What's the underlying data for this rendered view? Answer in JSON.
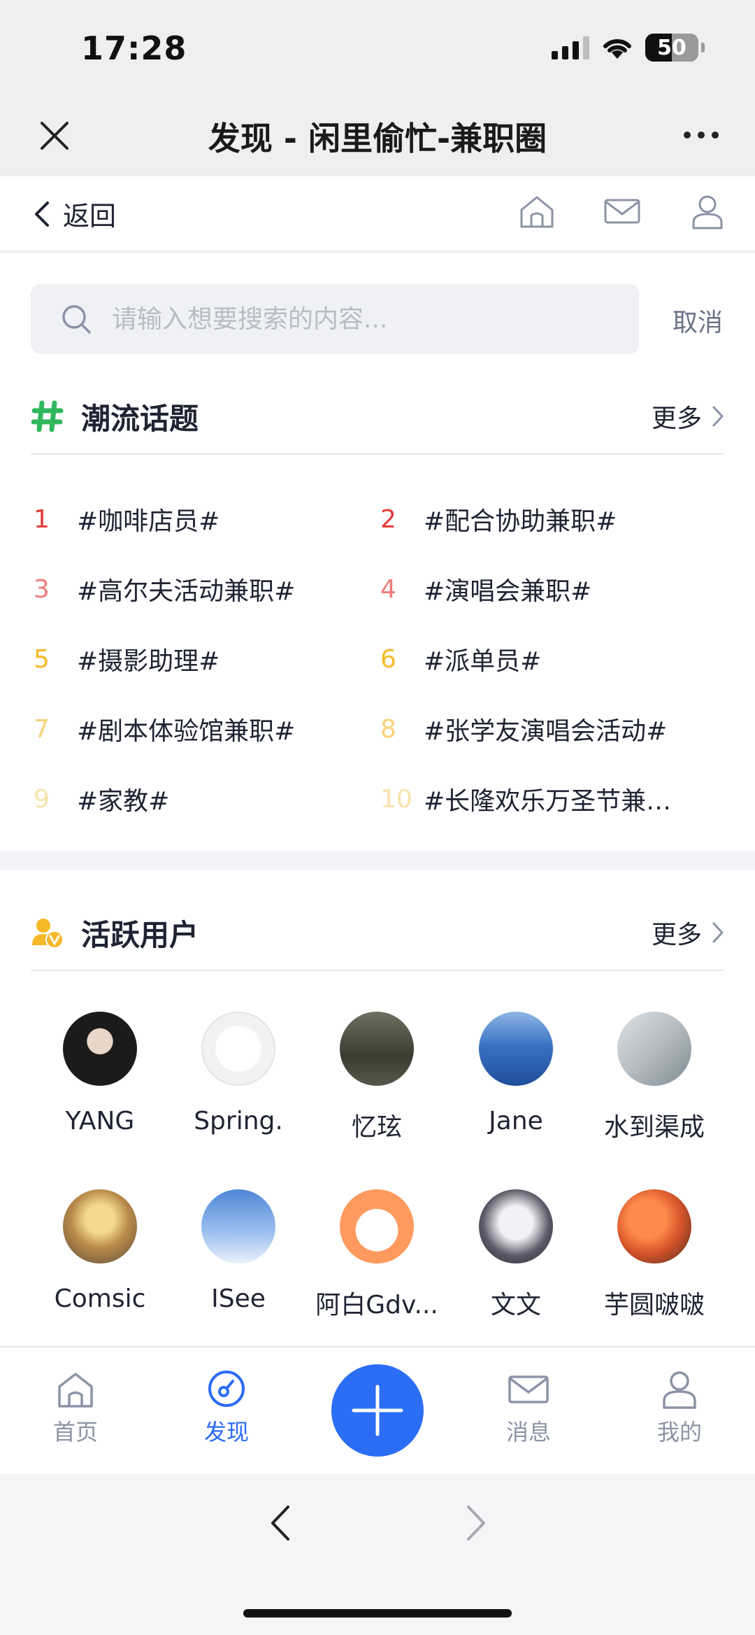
{
  "status_bar": {
    "time": "17:28",
    "battery": "50",
    "battery_level": 0.5
  },
  "title_bar": {
    "title": "发现 - 闲里偷忙-兼职圈"
  },
  "nav_bar": {
    "back_label": "返回"
  },
  "search": {
    "placeholder": "请输入想要搜索的内容...",
    "cancel_label": "取消"
  },
  "trending": {
    "title": "潮流话题",
    "more_label": "更多",
    "icon_color": "#2fb75b",
    "topics": [
      {
        "rank": "1",
        "name": "#咖啡店员#",
        "color": "#e53b3b"
      },
      {
        "rank": "2",
        "name": "#配合协助兼职#",
        "color": "#e53b3b"
      },
      {
        "rank": "3",
        "name": "#高尔夫活动兼职#",
        "color": "#ef7b7b"
      },
      {
        "rank": "4",
        "name": "#演唱会兼职#",
        "color": "#ef7b7b"
      },
      {
        "rank": "5",
        "name": "#摄影助理#",
        "color": "#f5b827"
      },
      {
        "rank": "6",
        "name": "#派单员#",
        "color": "#f5b827"
      },
      {
        "rank": "7",
        "name": "#剧本体验馆兼职#",
        "color": "#f7d376"
      },
      {
        "rank": "8",
        "name": "#张学友演唱会活动#",
        "color": "#f7d376"
      },
      {
        "rank": "9",
        "name": "#家教#",
        "color": "#f8e3a8"
      },
      {
        "rank": "10",
        "name": "#长隆欢乐万圣节兼职#",
        "color": "#f8e3a8"
      }
    ]
  },
  "active_users": {
    "title": "活跃用户",
    "more_label": "更多",
    "icon_color": "#f5b827",
    "users": [
      {
        "name": "YANG"
      },
      {
        "name": "Spring."
      },
      {
        "name": "忆玹"
      },
      {
        "name": "Jane"
      },
      {
        "name": "水到渠成"
      },
      {
        "name": "Comsic"
      },
      {
        "name": "ISee"
      },
      {
        "name": "阿白Gdv..."
      },
      {
        "name": "文文"
      },
      {
        "name": "芋圆啵啵"
      }
    ]
  },
  "tab_bar": {
    "tabs": [
      {
        "label": "首页"
      },
      {
        "label": "发现"
      },
      {
        "label": "消息"
      },
      {
        "label": "我的"
      }
    ],
    "active_color": "#2c6cf5",
    "inactive_color": "#8c93a6"
  }
}
